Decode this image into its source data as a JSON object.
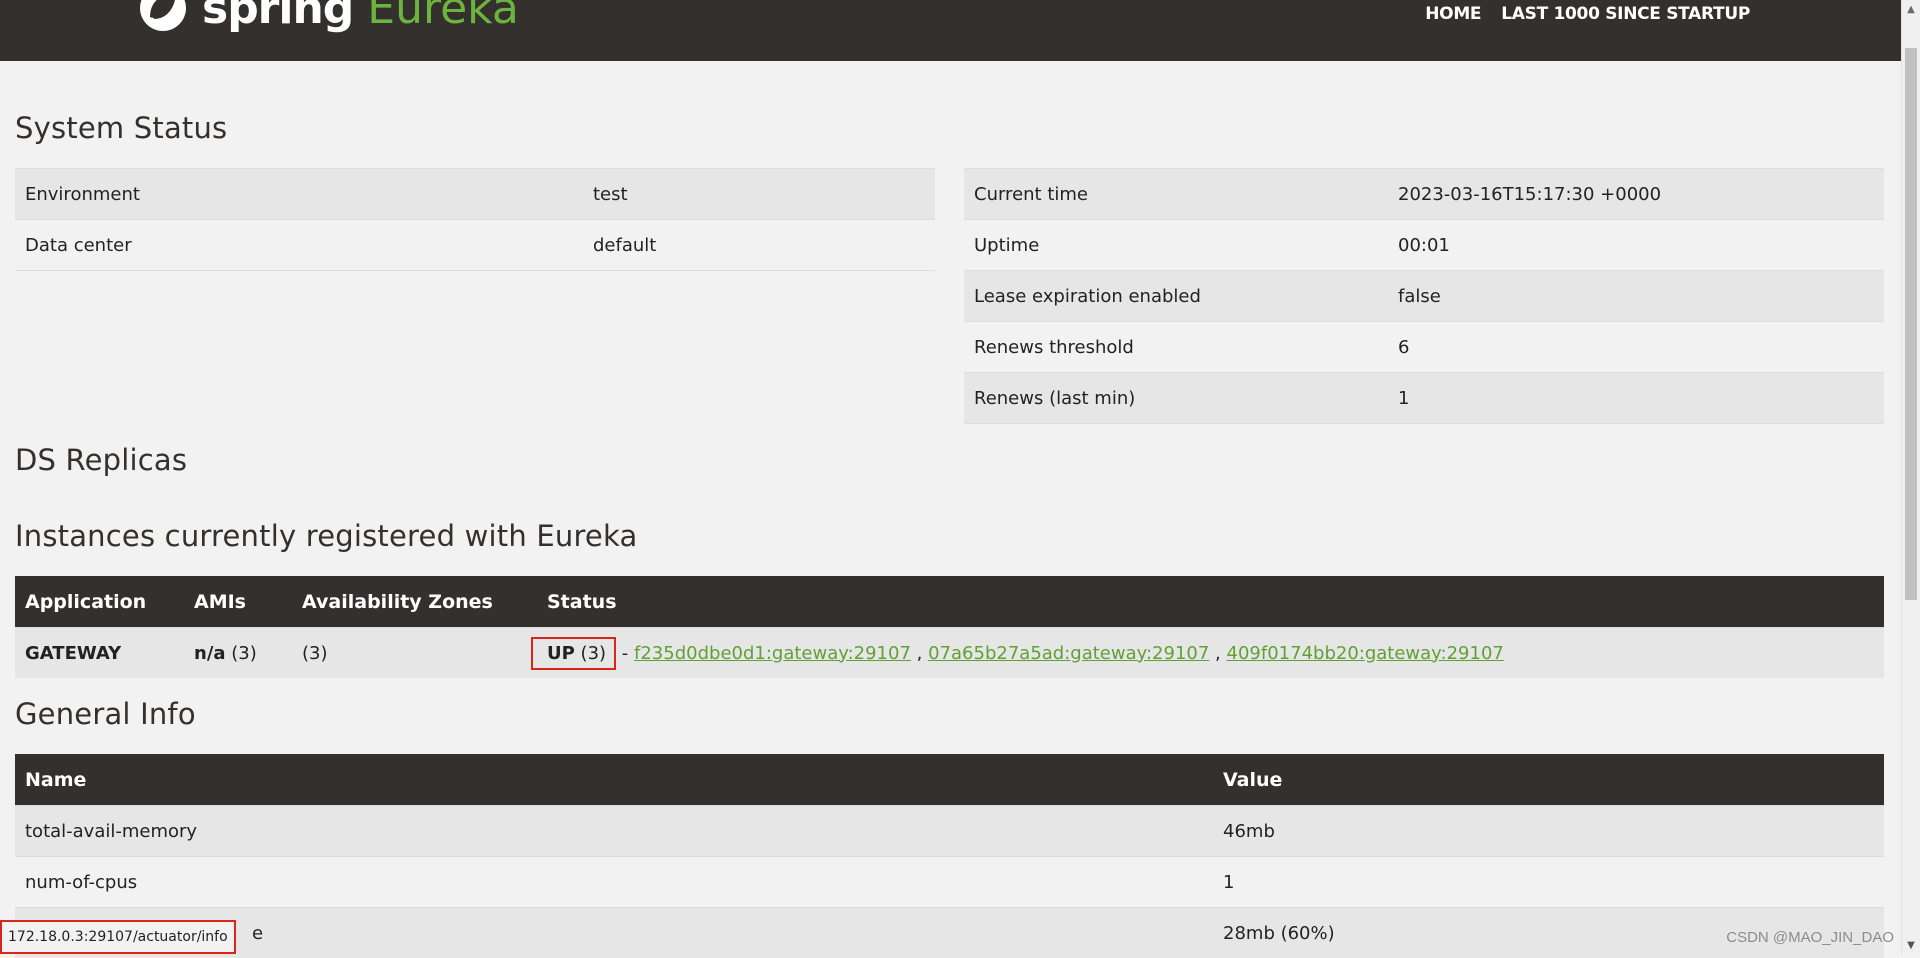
{
  "navbar": {
    "brand_spring": "spring",
    "brand_eureka": "Eureka",
    "links": [
      "HOME",
      "LAST 1000 SINCE STARTUP"
    ]
  },
  "system_status": {
    "heading": "System Status",
    "left": [
      {
        "key": "Environment",
        "value": "test"
      },
      {
        "key": "Data center",
        "value": "default"
      }
    ],
    "right": [
      {
        "key": "Current time",
        "value": "2023-03-16T15:17:30 +0000"
      },
      {
        "key": "Uptime",
        "value": "00:01"
      },
      {
        "key": "Lease expiration enabled",
        "value": "false"
      },
      {
        "key": "Renews threshold",
        "value": "6"
      },
      {
        "key": "Renews (last min)",
        "value": "1"
      }
    ]
  },
  "ds_replicas": {
    "heading": "DS Replicas"
  },
  "instances": {
    "heading": "Instances currently registered with Eureka",
    "columns": [
      "Application",
      "AMIs",
      "Availability Zones",
      "Status"
    ],
    "rows": [
      {
        "application": "GATEWAY",
        "amis_bold": "n/a",
        "amis_count": "(3)",
        "zones": "(3)",
        "status_bold": "UP",
        "status_count": "(3)",
        "separator": "-",
        "instance_links": [
          "f235d0dbe0d1:gateway:29107",
          "07a65b27a5ad:gateway:29107",
          "409f0174bb20:gateway:29107"
        ],
        "link_separator": ","
      }
    ]
  },
  "general_info": {
    "heading": "General Info",
    "columns": [
      "Name",
      "Value"
    ],
    "rows": [
      {
        "name": "total-avail-memory",
        "value": "46mb"
      },
      {
        "name": "num-of-cpus",
        "value": "1"
      },
      {
        "name": "e",
        "value": "28mb (60%)"
      }
    ]
  },
  "status_bar": {
    "url": "172.18.0.3:29107/actuator/info"
  },
  "watermark": "CSDN @MAO_JIN_DAO",
  "colors": {
    "navbar_bg": "#34302d",
    "brand_green": "#6db33f",
    "link_green": "#5fa134",
    "highlight_red": "#d9261c"
  }
}
